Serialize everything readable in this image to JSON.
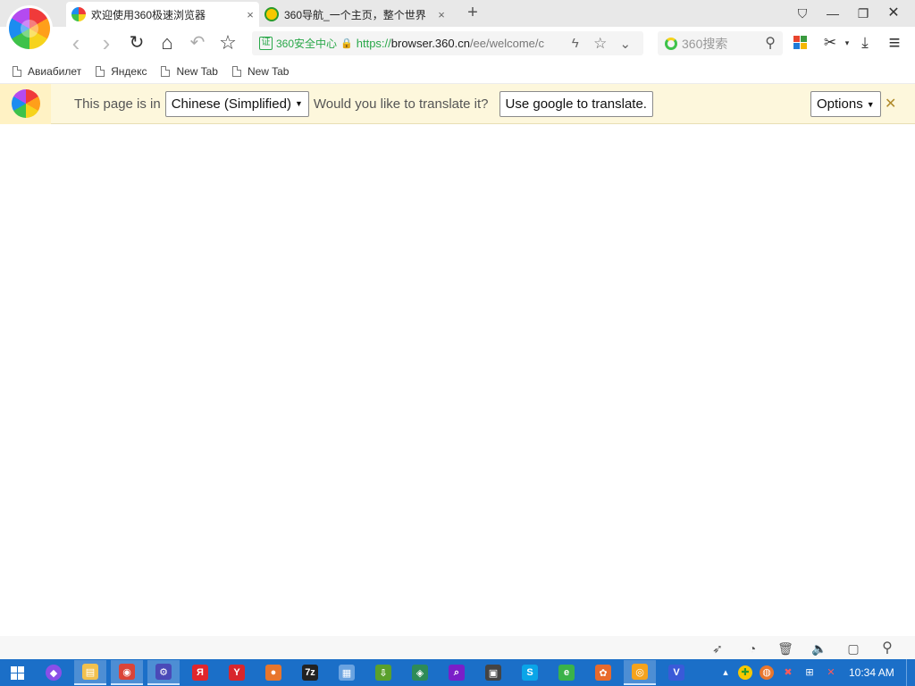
{
  "tabs": [
    {
      "title": "欢迎使用360极速浏览器",
      "close": "×"
    },
    {
      "title": "360导航_一个主页，整个世界",
      "close": "×"
    }
  ],
  "new_tab_symbol": "+",
  "window_controls": {
    "skin": "⛉",
    "minimize": "—",
    "restore": "❐",
    "close": "✕"
  },
  "nav": {
    "back": "‹",
    "forward": "›",
    "reload": "↻",
    "home": "⌂",
    "undo": "↶",
    "favorite": "☆"
  },
  "address": {
    "cert_badge": "证",
    "cert_label": "360安全中心",
    "lock": "🔒",
    "scheme": "https://",
    "host": "browser.360.cn",
    "path": "/ee/welcome/c"
  },
  "address_icons": {
    "flash": "ϟ",
    "star": "☆",
    "dropdown": "⌄"
  },
  "search": {
    "placeholder": "360搜索",
    "mag": "⚲"
  },
  "tools": {
    "scissors": "✂",
    "download": "⤓",
    "menu": "≡"
  },
  "apps_colors": [
    "#e8452e",
    "#3a9a3e",
    "#1f7bd8",
    "#f5b700"
  ],
  "bookmarks": [
    {
      "label": "Авиабилет"
    },
    {
      "label": "Яндекс"
    },
    {
      "label": "New Tab"
    },
    {
      "label": "New Tab"
    }
  ],
  "translate_bar": {
    "prompt": "This page is in",
    "language": "Chinese (Simplified)",
    "question": "Would you like to translate it?",
    "action": "Use google to translate.",
    "options": "Options",
    "close": "✕"
  },
  "status_icons": [
    "rocket-icon",
    "speedup-icon",
    "trash-icon",
    "volume-icon",
    "window-icon",
    "search-icon"
  ],
  "status_glyphs": [
    "➶",
    "◔",
    "🗑",
    "🔈",
    "▢",
    "⚲"
  ],
  "taskbar": {
    "apps": [
      {
        "name": "cortana",
        "glyph": "◆",
        "color": "#8a4fe8"
      },
      {
        "name": "file-explorer",
        "glyph": "▤",
        "color": "#f2c14e"
      },
      {
        "name": "chrome",
        "glyph": "◉",
        "color": "#db4437"
      },
      {
        "name": "settings",
        "glyph": "⚙",
        "color": "#4a4ab8"
      },
      {
        "name": "yandex",
        "glyph": "Я",
        "color": "#e0262c"
      },
      {
        "name": "yandex-browser",
        "glyph": "Y",
        "color": "#d8262c"
      },
      {
        "name": "firefox",
        "glyph": "●",
        "color": "#e8762c"
      },
      {
        "name": "7zip",
        "glyph": "7z",
        "color": "#222222"
      },
      {
        "name": "notepad",
        "glyph": "▦",
        "color": "#6aa3e0"
      },
      {
        "name": "downloader",
        "glyph": "⇩",
        "color": "#5aa02c"
      },
      {
        "name": "map-app",
        "glyph": "◈",
        "color": "#2e8b57"
      },
      {
        "name": "search-app",
        "glyph": "⌕",
        "color": "#7a1fc8"
      },
      {
        "name": "media-app",
        "glyph": "▣",
        "color": "#444444"
      },
      {
        "name": "skype",
        "glyph": "S",
        "color": "#0aa5e8"
      },
      {
        "name": "web-app",
        "glyph": "e",
        "color": "#3ab24a"
      },
      {
        "name": "colorful-app",
        "glyph": "✿",
        "color": "#e86a2c"
      },
      {
        "name": "360-browser",
        "glyph": "◎",
        "color": "#f6a31c"
      },
      {
        "name": "vpn-app",
        "glyph": "V",
        "color": "#3a5ad8"
      }
    ],
    "tray": [
      "▴",
      "✚",
      "◍",
      "✖",
      "⊞",
      "✕"
    ],
    "clock": "10:34 AM"
  }
}
